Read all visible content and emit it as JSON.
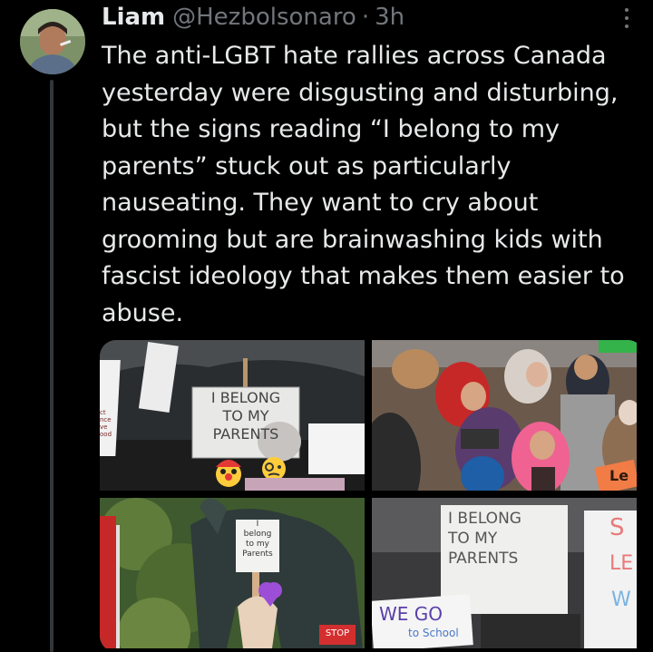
{
  "tweet": {
    "author_name": "Liam",
    "handle": "@Hezbolsonaro",
    "separator": "·",
    "time": "3h",
    "text": "The anti-LGBT hate rallies across Canada yesterday were disgusting and disturbing, but the signs reading “I belong to my parents” stuck out as particularly nauseating. They want to cry about grooming but are brainwashing kids with fascist ideology that makes them easier to abuse."
  },
  "media": {
    "photo1": {
      "sign_lines": [
        "I BELONG",
        "TO MY",
        "PARENTS"
      ],
      "left_sign_lines": [
        "ct",
        "nce",
        "ve",
        "ood"
      ]
    },
    "photo2": {
      "sign_partial": "Le"
    },
    "photo3": {
      "sign_lines": [
        "I",
        "belong",
        "to my",
        "Parents"
      ],
      "stop_sign": "STOP"
    },
    "photo4": {
      "sign_lines": [
        "I BELONG",
        "TO MY",
        "PARENTS"
      ],
      "bottom_sign": "WE GO",
      "bottom_sign_sub": "to School",
      "right_sign": "S",
      "right_sign_2": "LE",
      "right_sign_3": "W"
    }
  },
  "icons": {
    "more": "more-options-icon",
    "purple_heart": "purple-heart-emoji",
    "clown": "clown-emoji",
    "monocle": "monocle-emoji"
  }
}
